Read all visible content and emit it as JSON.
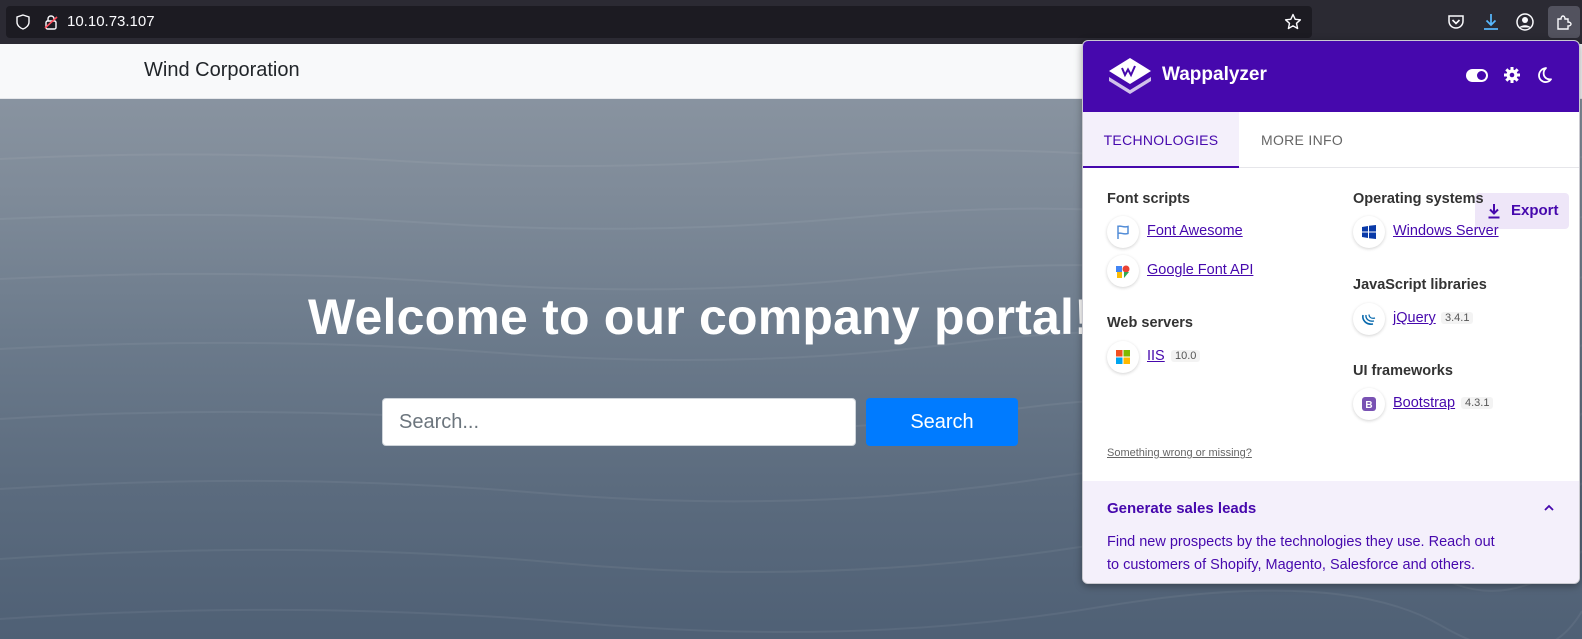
{
  "browser": {
    "url": "10.10.73.107"
  },
  "site": {
    "brand": "Wind Corporation",
    "hero_title": "Welcome to our company portal!",
    "search_placeholder": "Search...",
    "search_button": "Search"
  },
  "wappalyzer": {
    "name": "Wappalyzer",
    "tabs": {
      "technologies": "TECHNOLOGIES",
      "more_info": "MORE INFO"
    },
    "export_label": "Export",
    "categories": {
      "font_scripts": {
        "title": "Font scripts",
        "items": [
          {
            "name": "Font Awesome",
            "icon": "font-awesome-icon"
          },
          {
            "name": "Google Font API",
            "icon": "google-font-api-icon"
          }
        ]
      },
      "web_servers": {
        "title": "Web servers",
        "items": [
          {
            "name": "IIS",
            "version": "10.0",
            "icon": "iis-icon"
          }
        ]
      },
      "operating_systems": {
        "title": "Operating systems",
        "items": [
          {
            "name": "Windows Server",
            "icon": "windows-server-icon"
          }
        ]
      },
      "javascript_libraries": {
        "title": "JavaScript libraries",
        "items": [
          {
            "name": "jQuery",
            "version": "3.4.1",
            "icon": "jquery-icon"
          }
        ]
      },
      "ui_frameworks": {
        "title": "UI frameworks",
        "items": [
          {
            "name": "Bootstrap",
            "version": "4.3.1",
            "icon": "bootstrap-icon"
          }
        ]
      }
    },
    "feedback_link": "Something wrong or missing?",
    "leads": {
      "title": "Generate sales leads",
      "text": "Find new prospects by the technologies they use. Reach out to customers of Shopify, Magento, Salesforce and others."
    }
  },
  "colors": {
    "wappalyzer_purple": "#4608ad",
    "bootstrap_blue": "#007bff"
  }
}
